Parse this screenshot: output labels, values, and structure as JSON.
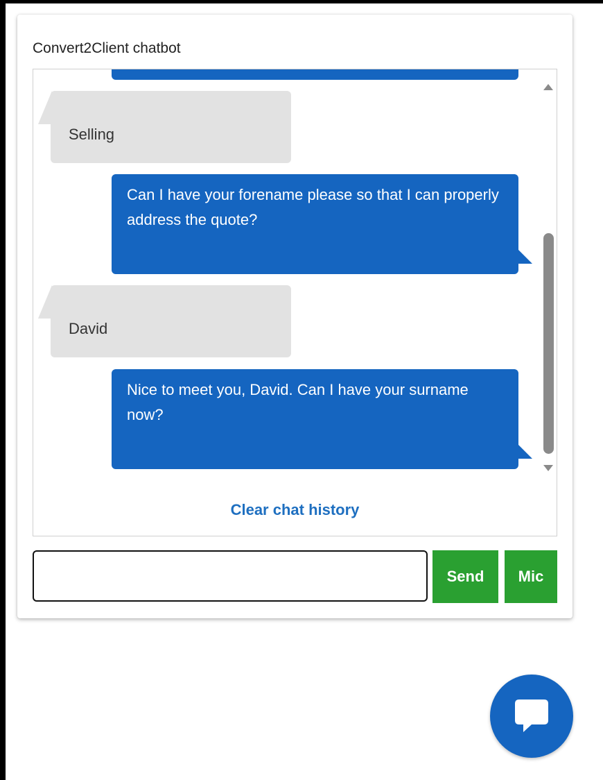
{
  "widget": {
    "title": "Convert2Client chatbot"
  },
  "messages": [
    {
      "sender": "user",
      "text": "Selling"
    },
    {
      "sender": "bot",
      "text": "Can I have your forename please so that I can properly address the quote?"
    },
    {
      "sender": "user",
      "text": "David"
    },
    {
      "sender": "bot",
      "text": "Nice to meet you, David. Can I have your surname now?"
    }
  ],
  "chat": {
    "clear_label": "Clear chat history"
  },
  "composer": {
    "input_value": "",
    "send_label": "Send",
    "mic_label": "Mic"
  },
  "launcher": {
    "icon": "chat-bubble-icon"
  },
  "colors": {
    "bot_bubble": "#1565c0",
    "user_bubble": "#e2e2e2",
    "button_green": "#2aa031",
    "link_blue": "#1e6fc0"
  }
}
